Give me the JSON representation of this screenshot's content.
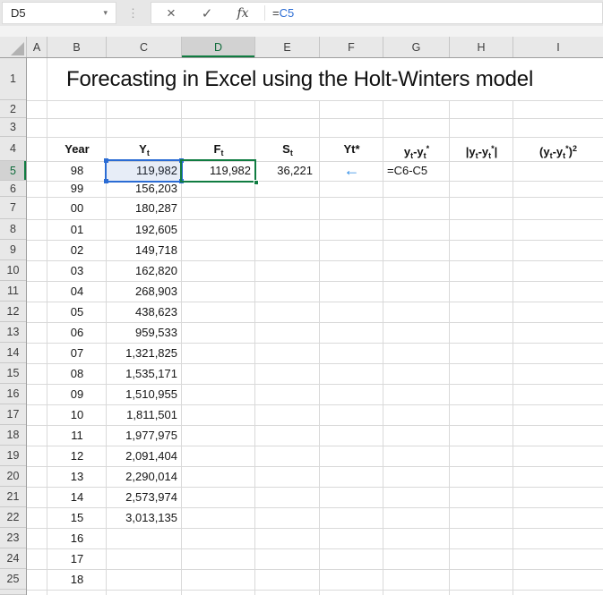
{
  "name_box": {
    "value": "D5"
  },
  "icons": {
    "dropdown": "▾",
    "dots": "⋮",
    "cancel": "×",
    "enter": "✓",
    "fx": "fx"
  },
  "formula_bar": {
    "eq": "=",
    "ref": "C5"
  },
  "sheet": {
    "col_headers": [
      "A",
      "B",
      "C",
      "D",
      "E",
      "F",
      "G",
      "H",
      "I"
    ],
    "selected_column": "D",
    "selected_row": "5",
    "row_numbers": [
      "1",
      "2",
      "3",
      "4"
    ],
    "title": "Forecasting in Excel using the Holt-Winters model",
    "table_headers": {
      "year": [
        {
          "t": "Year"
        }
      ],
      "yt": [
        {
          "t": "Y"
        },
        {
          "sub": "t"
        }
      ],
      "ft": [
        {
          "t": "F"
        },
        {
          "sub": "t"
        }
      ],
      "st": [
        {
          "t": "S"
        },
        {
          "sub": "t"
        }
      ],
      "ytstar": [
        {
          "t": "Yt*"
        }
      ],
      "diff": [
        {
          "t": "y"
        },
        {
          "sub": "t"
        },
        {
          "t": "-y"
        },
        {
          "sub": "t"
        },
        {
          "sup": "*"
        }
      ],
      "absdiff": [
        {
          "t": "|y"
        },
        {
          "sub": "t"
        },
        {
          "t": "-y"
        },
        {
          "sub": "t"
        },
        {
          "sup": "*"
        },
        {
          "t": "|"
        }
      ],
      "sqdiff": [
        {
          "t": "(y"
        },
        {
          "sub": "t"
        },
        {
          "t": "-y"
        },
        {
          "sub": "t"
        },
        {
          "sup": "*"
        },
        {
          "t": ")"
        },
        {
          "sup": "2"
        }
      ]
    },
    "rows": [
      {
        "n": "5",
        "year": "98",
        "yt": "119,982",
        "ft": "119,982",
        "st": "36,221",
        "arrow": "←",
        "formula_text": "=C6-C5"
      },
      {
        "n": "6",
        "year": "99",
        "yt": "156,203"
      },
      {
        "n": "7",
        "year": "00",
        "yt": "180,287"
      },
      {
        "n": "8",
        "year": "01",
        "yt": "192,605"
      },
      {
        "n": "9",
        "year": "02",
        "yt": "149,718"
      },
      {
        "n": "10",
        "year": "03",
        "yt": "162,820"
      },
      {
        "n": "11",
        "year": "04",
        "yt": "268,903"
      },
      {
        "n": "12",
        "year": "05",
        "yt": "438,623"
      },
      {
        "n": "13",
        "year": "06",
        "yt": "959,533"
      },
      {
        "n": "14",
        "year": "07",
        "yt": "1,321,825"
      },
      {
        "n": "15",
        "year": "08",
        "yt": "1,535,171"
      },
      {
        "n": "16",
        "year": "09",
        "yt": "1,510,955"
      },
      {
        "n": "17",
        "year": "10",
        "yt": "1,811,501"
      },
      {
        "n": "18",
        "year": "11",
        "yt": "1,977,975"
      },
      {
        "n": "19",
        "year": "12",
        "yt": "2,091,404"
      },
      {
        "n": "20",
        "year": "13",
        "yt": "2,290,014"
      },
      {
        "n": "21",
        "year": "14",
        "yt": "2,573,974"
      },
      {
        "n": "22",
        "year": "15",
        "yt": "3,013,135"
      },
      {
        "n": "23",
        "year": "16"
      },
      {
        "n": "24",
        "year": "17"
      },
      {
        "n": "25",
        "year": "18"
      }
    ],
    "colors": {
      "selection_green": "#107c41",
      "reference_blue": "#2b6cd4",
      "arrow_blue": "#2e8ce6"
    }
  }
}
